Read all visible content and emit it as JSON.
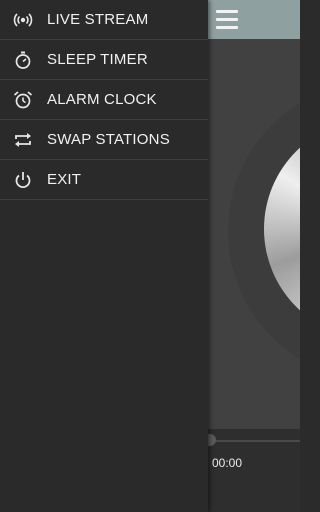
{
  "drawer": {
    "items": [
      {
        "label": "LIVE STREAM",
        "icon": "broadcast-icon"
      },
      {
        "label": "SLEEP TIMER",
        "icon": "stopwatch-icon"
      },
      {
        "label": "ALARM CLOCK",
        "icon": "alarm-clock-icon"
      },
      {
        "label": "SWAP STATIONS",
        "icon": "swap-icon"
      },
      {
        "label": "EXIT",
        "icon": "power-icon"
      }
    ]
  },
  "toolbar": {
    "menu_icon": "hamburger-menu-icon"
  },
  "player": {
    "time": "00:00"
  }
}
